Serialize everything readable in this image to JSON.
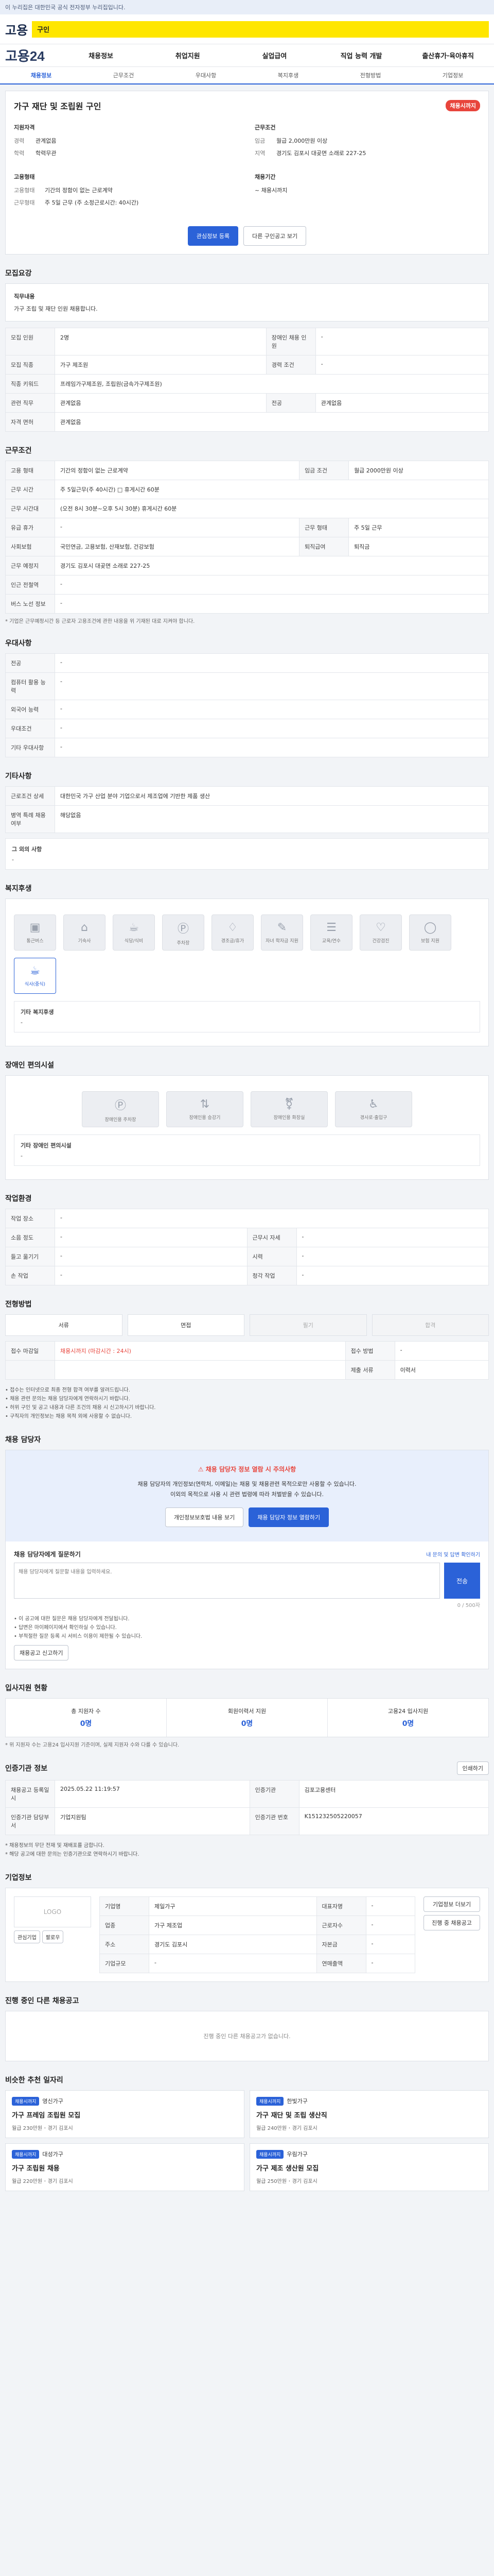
{
  "topbar": {
    "text": "이 누리집은 대한민국 공식 전자정부 누리집입니다."
  },
  "header": {
    "logo": "고용",
    "search_label": "구인"
  },
  "gnb": {
    "logo": "고용24",
    "items": [
      "채용정보",
      "취업지원",
      "실업급여",
      "직업 능력 개발",
      "출산휴가·육아휴직"
    ]
  },
  "tabs": [
    "채용정보",
    "근무조건",
    "우대사항",
    "복지후생",
    "전형방법",
    "기업정보"
  ],
  "job": {
    "title": "가구 재단 및 조립원 구인",
    "badge": "채용시까지",
    "left_head": "지원자격",
    "left_rows": [
      {
        "k": "경력",
        "v": "관계없음"
      },
      {
        "k": "학력",
        "v": "학력무관"
      }
    ],
    "right_head": "근무조건",
    "right_rows": [
      {
        "k": "임금",
        "v": "월급 2,000만원 이상"
      },
      {
        "k": "지역",
        "v": "경기도 김포시 대곶면 소래로 227-25"
      }
    ],
    "left2_head": "고용형태",
    "left2_rows": [
      {
        "k": "고용형태",
        "v": "기간의 정함이 없는 근로계약"
      },
      {
        "k": "근무형태",
        "v": "주 5일 근무 (주 소정근로시간: 40시간)"
      }
    ],
    "right2_head": "채용기간",
    "right2_val": "~ 채용시까지",
    "btn_apply": "관심정보 등록",
    "btn_online": "다른 구인공고 보기"
  },
  "recruit": {
    "title": "모집요강",
    "duty_label": "직무내용",
    "duty_text": "가구 조립 및 재단 인원 채용합니다.",
    "rows": [
      {
        "k1": "모집 인원",
        "v1": "2명",
        "k2": "장애인 채용 인원",
        "v2": "-"
      },
      {
        "k1": "모집 직종",
        "v1": "가구 제조원",
        "k2": "경력 조건",
        "v2": "-"
      },
      {
        "k1": "직종 키워드",
        "v1": "프레임가구제조원, 조립원(금속가구제조원)",
        "k2": "",
        "v2": ""
      },
      {
        "k1": "관련 직무",
        "v1": "관계없음",
        "k2": "전공",
        "v2": "관계없음"
      },
      {
        "k1": "자격 면허",
        "v1": "관계없음",
        "k2": "",
        "v2": ""
      }
    ]
  },
  "conditions": {
    "title": "근무조건",
    "rows": [
      {
        "k": "고용 형태",
        "v": "기간의 정함이 없는 근로계약",
        "k2": "임금 조건",
        "v2": "월급 2000만원 이상"
      },
      {
        "k": "근무 시간",
        "v": "주 5일근무(주 40시간)  □ 휴게시간 60분"
      },
      {
        "k": "근무 시간대",
        "v": "(오전 8시 30분~오후 5시 30분) 휴게시간 60분"
      },
      {
        "k": "유급 휴가",
        "v": "-",
        "k2": "근무 형태",
        "v2": "주 5일 근무"
      },
      {
        "k": "사회보험",
        "v": "국민연금, 고용보험, 산재보험, 건강보험",
        "k2": "퇴직급여",
        "v2": "퇴직금"
      },
      {
        "k": "근무 예정지",
        "v": "경기도 김포시 대곶면 소래로 227-25"
      },
      {
        "k": "인근 전철역",
        "v": "-"
      },
      {
        "k": "버스 노선 정보",
        "v": "-"
      }
    ],
    "note": "* 기업은 근무예정시간 등 근로자 고용조건에 관한 내용을 위 기재된 대로 지켜야 합니다."
  },
  "prefer": {
    "title": "우대사항",
    "rows": [
      {
        "k": "전공",
        "v": "-"
      },
      {
        "k": "컴퓨터 활용 능력",
        "v": "-"
      },
      {
        "k": "외국어 능력",
        "v": "-"
      },
      {
        "k": "우대조건",
        "v": "-"
      },
      {
        "k": "기타 우대사항",
        "v": "-"
      }
    ]
  },
  "etc": {
    "title": "기타사항",
    "rows": [
      {
        "k": "근로조건 상세",
        "v": "대한민국 가구 산업 분야 기업으로서 제조업에 기반한 제품 생산"
      },
      {
        "k": "병역 특례 채용 여부",
        "v": "해당없음"
      }
    ],
    "more_label": "그 외의 사항",
    "more_text": "-"
  },
  "welfare": {
    "title": "복지후생",
    "tiles": [
      "통근버스",
      "기숙사",
      "식당/식비",
      "주차장",
      "경조금/휴가",
      "자녀 학자금 지원",
      "교육/연수",
      "건강검진",
      "보험 지원",
      "식사(중식)"
    ],
    "active": [
      9
    ],
    "more_label": "기타 복지후생",
    "more_text": "-"
  },
  "disabled": {
    "title": "장애인 편의시설",
    "tiles": [
      "장애인용 주차장",
      "장애인용 승강기",
      "장애인용 화장실",
      "경사로·출입구"
    ],
    "more_label": "기타 장애인 편의시설",
    "more_text": "-"
  },
  "workenv": {
    "title": "작업환경",
    "rows": [
      {
        "k": "작업 장소",
        "v": "-",
        "k2": "",
        "v2": ""
      },
      {
        "k": "소음 정도",
        "v": "-",
        "k2": "근무시 자세",
        "v2": "-"
      },
      {
        "k": "들고 옮기기",
        "v": "-",
        "k2": "시력",
        "v2": "-"
      },
      {
        "k": "손 작업",
        "v": "-",
        "k2": "청각 작업",
        "v2": "-"
      }
    ]
  },
  "screening": {
    "title": "전형방법",
    "steps": [
      "서류",
      "면접",
      "필기",
      "합격"
    ],
    "off": [
      2,
      3
    ],
    "rows": [
      {
        "k": "접수 마감일",
        "v": "채용시까지 (마감시간 : 24시)",
        "k2": "접수 방법",
        "v2": "-"
      },
      {
        "k": "",
        "v": "",
        "k2": "제출 서류",
        "v2": "이력서"
      }
    ],
    "bullets": [
      "• 접수는 인터넷으로 최종 전형 합격 여부를 알려드립니다.",
      "• 채용 관련 문의는 채용 담당자에게 연락하시기 바랍니다.",
      "• 허위 구인 및 공고 내용과 다른 조건의 채용 시 신고하시기 바랍니다.",
      "• 구직자의 개인정보는 채용 목적 외에 사용할 수 없습니다."
    ]
  },
  "manager": {
    "title": "채용 담당자",
    "warn": "채용 담당자 정보 열람 시 주의사항",
    "desc1": "채용 담당자의 개인정보(연락처, 이메일)는 채용 및 채용관련 목적으로만 사용할 수 있습니다.",
    "desc2": "이외의 목적으로 사용 시 관련 법령에 따라 처벌받을 수 있습니다.",
    "btn_agree": "개인정보보호법 내용 보기",
    "btn_view": "채용 담당자 정보 열람하기",
    "inquiry_title": "채용 담당자에게 질문하기",
    "inquiry_link": "내 문의 및 답변 확인하기",
    "inquiry_placeholder": "채용 담당자에게 질문할 내용을 입력하세요.",
    "inquiry_send": "전송",
    "inquiry_count": "0 / 500자",
    "notes": [
      "• 이 공고에 대한 질문은 채용 담당자에게 전달됩니다.",
      "• 답변은 마이페이지에서 확인하실 수 있습니다.",
      "• 부적절한 질문 등록 시 서비스 이용이 제한될 수 있습니다."
    ],
    "report_btn": "채용공고 신고하기"
  },
  "applicants": {
    "title": "입사지원 현황",
    "stats": [
      {
        "k": "총 지원자 수",
        "v": "0명"
      },
      {
        "k": "회원이력서 지원",
        "v": "0명"
      },
      {
        "k": "고용24 입사지원",
        "v": "0명"
      }
    ],
    "note": "* 위 지원자 수는 고용24 입사지원 기준이며, 실제 지원자 수와 다를 수 있습니다."
  },
  "info": {
    "title": "인증기관 정보",
    "print_btn": "인쇄하기",
    "rows": [
      {
        "k": "채용공고 등록일시",
        "v": "2025.05.22 11:19:57",
        "k2": "인증기관",
        "v2": "김포고용센터"
      },
      {
        "k": "인증기관 담당부서",
        "v": "기업지원팀",
        "k2": "인증기관 번호",
        "v2": "K151232505220057"
      }
    ],
    "notes": [
      "* 채용정보의 무단 전재 및 재배포를 금합니다.",
      "* 해당 공고에 대한 문의는 인증기관으로 연락하시기 바랍니다."
    ]
  },
  "company": {
    "title": "기업정보",
    "logo_text": "LOGO",
    "btn_interest": "관심기업",
    "btn_follow": "팔로우",
    "rows": [
      {
        "k": "기업명",
        "v": "제일가구",
        "k2": "대표자명",
        "v2": "-"
      },
      {
        "k": "업종",
        "v": "가구 제조업",
        "k2": "근로자수",
        "v2": "-"
      },
      {
        "k": "주소",
        "v": "경기도 김포시",
        "k2": "자본금",
        "v2": "-"
      },
      {
        "k": "기업규모",
        "v": "-",
        "k2": "연매출액",
        "v2": "-"
      }
    ],
    "btn_more": "기업정보 더보기",
    "btn_jobs": "진행 중 채용공고"
  },
  "other": {
    "title": "진행 중인 다른 채용공고",
    "empty": "진행 중인 다른 채용공고가 없습니다."
  },
  "recommend": {
    "title": "비슷한 추천 일자리",
    "cards": [
      {
        "tag": "채용시까지",
        "company": "영신가구",
        "title": "가구 프레임 조립원 모집",
        "wage": "월급 230만원",
        "loc": "경기 김포시"
      },
      {
        "tag": "채용시까지",
        "company": "한빛가구",
        "title": "가구 재단 및 조립 생산직",
        "wage": "월급 240만원",
        "loc": "경기 김포시"
      },
      {
        "tag": "채용시까지",
        "company": "대성가구",
        "title": "가구 조립원 채용",
        "wage": "월급 220만원",
        "loc": "경기 김포시"
      },
      {
        "tag": "채용시까지",
        "company": "우림가구",
        "title": "가구 제조 생산원 모집",
        "wage": "월급 250만원",
        "loc": "경기 김포시"
      }
    ]
  }
}
